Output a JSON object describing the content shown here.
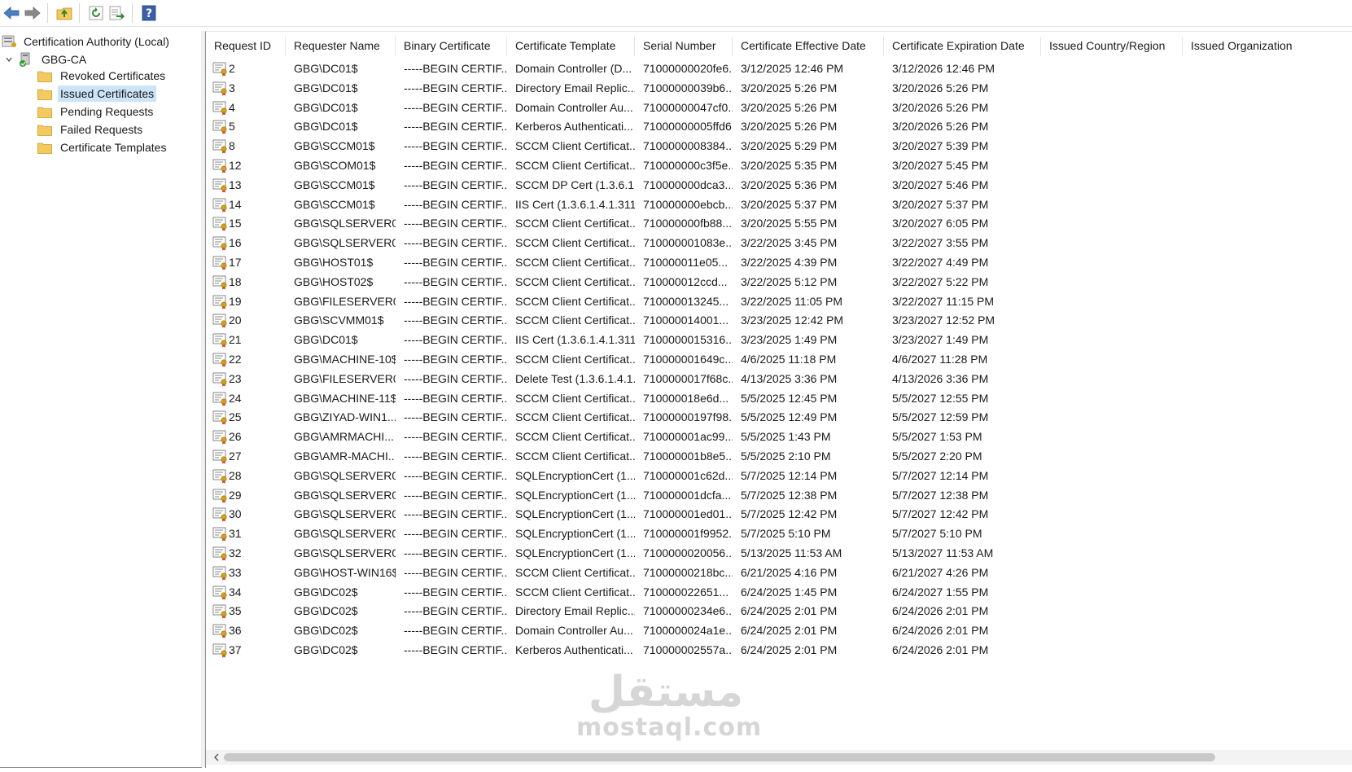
{
  "tree": {
    "root": "Certification Authority (Local)",
    "ca": "GBG-CA",
    "children": [
      "Revoked Certificates",
      "Issued Certificates",
      "Pending Requests",
      "Failed Requests",
      "Certificate Templates"
    ],
    "selected_index": 1
  },
  "columns": [
    "Request ID",
    "Requester Name",
    "Binary Certificate",
    "Certificate Template",
    "Serial Number",
    "Certificate Effective Date",
    "Certificate Expiration Date",
    "Issued Country/Region",
    "Issued Organization"
  ],
  "rows": [
    [
      "2",
      "GBG\\DC01$",
      "-----BEGIN CERTIF...",
      "Domain Controller (D...",
      "71000000020fe6...",
      "3/12/2025 12:46 PM",
      "3/12/2026 12:46 PM"
    ],
    [
      "3",
      "GBG\\DC01$",
      "-----BEGIN CERTIF...",
      "Directory Email Replic...",
      "71000000039b6...",
      "3/20/2025 5:26 PM",
      "3/20/2026 5:26 PM"
    ],
    [
      "4",
      "GBG\\DC01$",
      "-----BEGIN CERTIF...",
      "Domain Controller Au...",
      "71000000047cf0...",
      "3/20/2025 5:26 PM",
      "3/20/2026 5:26 PM"
    ],
    [
      "5",
      "GBG\\DC01$",
      "-----BEGIN CERTIF...",
      "Kerberos Authenticati...",
      "71000000005ffd6...",
      "3/20/2025 5:26 PM",
      "3/20/2026 5:26 PM"
    ],
    [
      "8",
      "GBG\\SCCM01$",
      "-----BEGIN CERTIF...",
      "SCCM Client Certificat...",
      "7100000008384...",
      "3/20/2025 5:29 PM",
      "3/20/2027 5:39 PM"
    ],
    [
      "12",
      "GBG\\SCOM01$",
      "-----BEGIN CERTIF...",
      "SCCM Client Certificat...",
      "710000000c3f5e...",
      "3/20/2025 5:35 PM",
      "3/20/2027 5:45 PM"
    ],
    [
      "13",
      "GBG\\SCCM01$",
      "-----BEGIN CERTIF...",
      "SCCM DP Cert (1.3.6.1....",
      "710000000dca3...",
      "3/20/2025 5:36 PM",
      "3/20/2027 5:46 PM"
    ],
    [
      "14",
      "GBG\\SCCM01$",
      "-----BEGIN CERTIF...",
      "IIS Cert (1.3.6.1.4.1.311....",
      "710000000ebcb...",
      "3/20/2025 5:37 PM",
      "3/20/2027 5:37 PM"
    ],
    [
      "15",
      "GBG\\SQLSERVER0...",
      "-----BEGIN CERTIF...",
      "SCCM Client Certificat...",
      "710000000fb88...",
      "3/20/2025 5:55 PM",
      "3/20/2027 6:05 PM"
    ],
    [
      "16",
      "GBG\\SQLSERVER0...",
      "-----BEGIN CERTIF...",
      "SCCM Client Certificat...",
      "710000001083e...",
      "3/22/2025 3:45 PM",
      "3/22/2027 3:55 PM"
    ],
    [
      "17",
      "GBG\\HOST01$",
      "-----BEGIN CERTIF...",
      "SCCM Client Certificat...",
      "710000011e05...",
      "3/22/2025 4:39 PM",
      "3/22/2027 4:49 PM"
    ],
    [
      "18",
      "GBG\\HOST02$",
      "-----BEGIN CERTIF...",
      "SCCM Client Certificat...",
      "710000012ccd...",
      "3/22/2025 5:12 PM",
      "3/22/2027 5:22 PM"
    ],
    [
      "19",
      "GBG\\FILESERVER0...",
      "-----BEGIN CERTIF...",
      "SCCM Client Certificat...",
      "710000013245...",
      "3/22/2025 11:05 PM",
      "3/22/2027 11:15 PM"
    ],
    [
      "20",
      "GBG\\SCVMM01$",
      "-----BEGIN CERTIF...",
      "SCCM Client Certificat...",
      "710000014001...",
      "3/23/2025 12:42 PM",
      "3/23/2027 12:52 PM"
    ],
    [
      "21",
      "GBG\\DC01$",
      "-----BEGIN CERTIF...",
      "IIS Cert (1.3.6.1.4.1.311....",
      "7100000015316...",
      "3/23/2025 1:49 PM",
      "3/23/2027 1:49 PM"
    ],
    [
      "22",
      "GBG\\MACHINE-10$",
      "-----BEGIN CERTIF...",
      "SCCM Client Certificat...",
      "710000001649c...",
      "4/6/2025 11:18 PM",
      "4/6/2027 11:28 PM"
    ],
    [
      "23",
      "GBG\\FILESERVER0...",
      "-----BEGIN CERTIF...",
      "Delete Test (1.3.6.1.4.1....",
      "7100000017f68c...",
      "4/13/2025 3:36 PM",
      "4/13/2026 3:36 PM"
    ],
    [
      "24",
      "GBG\\MACHINE-11$",
      "-----BEGIN CERTIF...",
      "SCCM Client Certificat...",
      "710000018e6d...",
      "5/5/2025 12:45 PM",
      "5/5/2027 12:55 PM"
    ],
    [
      "25",
      "GBG\\ZIYAD-WIN1...",
      "-----BEGIN CERTIF...",
      "SCCM Client Certificat...",
      "71000000197f98...",
      "5/5/2025 12:49 PM",
      "5/5/2027 12:59 PM"
    ],
    [
      "26",
      "GBG\\AMRMACHI...",
      "-----BEGIN CERTIF...",
      "SCCM Client Certificat...",
      "710000001ac99...",
      "5/5/2025 1:43 PM",
      "5/5/2027 1:53 PM"
    ],
    [
      "27",
      "GBG\\AMR-MACHI...",
      "-----BEGIN CERTIF...",
      "SCCM Client Certificat...",
      "710000001b8e5...",
      "5/5/2025 2:10 PM",
      "5/5/2027 2:20 PM"
    ],
    [
      "28",
      "GBG\\SQLSERVER0...",
      "-----BEGIN CERTIF...",
      "SQLEncryptionCert (1....",
      "710000001c62d...",
      "5/7/2025 12:14 PM",
      "5/7/2027 12:14 PM"
    ],
    [
      "29",
      "GBG\\SQLSERVER0...",
      "-----BEGIN CERTIF...",
      "SQLEncryptionCert (1....",
      "710000001dcfa...",
      "5/7/2025 12:38 PM",
      "5/7/2027 12:38 PM"
    ],
    [
      "30",
      "GBG\\SQLSERVER0...",
      "-----BEGIN CERTIF...",
      "SQLEncryptionCert (1....",
      "710000001ed01...",
      "5/7/2025 12:42 PM",
      "5/7/2027 12:42 PM"
    ],
    [
      "31",
      "GBG\\SQLSERVER0...",
      "-----BEGIN CERTIF...",
      "SQLEncryptionCert (1....",
      "710000001f9952...",
      "5/7/2025 5:10 PM",
      "5/7/2027 5:10 PM"
    ],
    [
      "32",
      "GBG\\SQLSERVER0...",
      "-----BEGIN CERTIF...",
      "SQLEncryptionCert (1....",
      "7100000020056...",
      "5/13/2025 11:53 AM",
      "5/13/2027 11:53 AM"
    ],
    [
      "33",
      "GBG\\HOST-WIN16$",
      "-----BEGIN CERTIF...",
      "SCCM Client Certificat...",
      "71000000218bc...",
      "6/21/2025 4:16 PM",
      "6/21/2027 4:26 PM"
    ],
    [
      "34",
      "GBG\\DC02$",
      "-----BEGIN CERTIF...",
      "SCCM Client Certificat...",
      "710000022651...",
      "6/24/2025 1:45 PM",
      "6/24/2027 1:55 PM"
    ],
    [
      "35",
      "GBG\\DC02$",
      "-----BEGIN CERTIF...",
      "Directory Email Replic...",
      "71000000234e6...",
      "6/24/2025 2:01 PM",
      "6/24/2026 2:01 PM"
    ],
    [
      "36",
      "GBG\\DC02$",
      "-----BEGIN CERTIF...",
      "Domain Controller Au...",
      "7100000024a1e...",
      "6/24/2025 2:01 PM",
      "6/24/2026 2:01 PM"
    ],
    [
      "37",
      "GBG\\DC02$",
      "-----BEGIN CERTIF...",
      "Kerberos Authenticati...",
      "710000002557a...",
      "6/24/2025 2:01 PM",
      "6/24/2026 2:01 PM"
    ]
  ],
  "icons": {
    "back": "back-arrow-icon",
    "forward": "forward-arrow-icon",
    "up": "up-folder-icon",
    "refresh": "refresh-icon",
    "export": "export-list-icon",
    "help": "help-icon",
    "row": "certificate-icon"
  },
  "watermark": {
    "arabic": "مستقل",
    "latin": "mostaql.com"
  },
  "colors": {
    "selection": "#cce4f7",
    "folder": "#f4c95d",
    "arrow": "#4a7fc1"
  }
}
